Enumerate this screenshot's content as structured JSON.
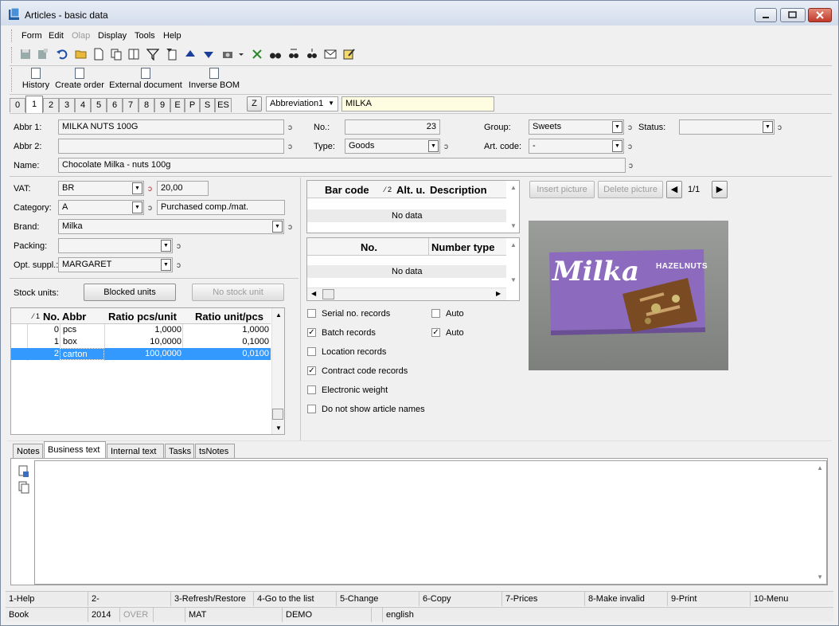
{
  "window": {
    "title": "Articles - basic data"
  },
  "menu": [
    "Form",
    "Edit",
    "Olap",
    "Display",
    "Tools",
    "Help"
  ],
  "actions": [
    "History",
    "Create order",
    "External document",
    "Inverse BOM"
  ],
  "tabs": [
    "0",
    "1",
    "2",
    "3",
    "4",
    "5",
    "6",
    "7",
    "8",
    "9",
    "E",
    "P",
    "S",
    "ES"
  ],
  "tabs_active": "1",
  "z_button": "Z",
  "search": {
    "mode": "Abbreviation1",
    "value": "MILKA"
  },
  "form": {
    "abbr1_label": "Abbr 1:",
    "abbr1": "MILKA NUTS 100G",
    "abbr2_label": "Abbr 2:",
    "abbr2": "",
    "name_label": "Name:",
    "name": "Chocolate Milka - nuts 100g",
    "no_label": "No.:",
    "no": "23",
    "type_label": "Type:",
    "type": "Goods",
    "group_label": "Group:",
    "group": "Sweets",
    "status_label": "Status:",
    "status": "",
    "artcode_label": "Art. code:",
    "artcode": "-",
    "vat_label": "VAT:",
    "vat": "BR",
    "vat_rate": "20,00",
    "category_label": "Category:",
    "category": "A",
    "category_desc": "Purchased comp./mat.",
    "brand_label": "Brand:",
    "brand": "Milka",
    "packing_label": "Packing:",
    "packing": "",
    "supplier_label": "Opt. suppl.:",
    "supplier": "MARGARET"
  },
  "stock": {
    "label": "Stock units:",
    "blocked_button": "Blocked units",
    "no_stock_button": "No stock unit",
    "sort_marker": "⁄ 1",
    "columns": [
      "No.",
      "Abbr",
      "Ratio pcs/unit",
      "Ratio unit/pcs"
    ],
    "rows": [
      {
        "no": "0",
        "abbr": "pcs",
        "ratio1": "1,0000",
        "ratio2": "1,0000"
      },
      {
        "no": "1",
        "abbr": "box",
        "ratio1": "10,0000",
        "ratio2": "0,1000"
      },
      {
        "no": "2",
        "abbr": "carton",
        "ratio1": "100,0000",
        "ratio2": "0,0100"
      }
    ]
  },
  "barcode_grid": {
    "columns": [
      "Bar code",
      "⁄ 2",
      "Alt. u.",
      "Description"
    ],
    "empty": "No data"
  },
  "numbers_grid": {
    "columns": [
      "No.",
      "Number type"
    ],
    "empty": "No data"
  },
  "checkboxes": [
    {
      "label": "Serial no. records",
      "checked": false
    },
    {
      "label": "Batch records",
      "checked": true
    },
    {
      "label": "Location records",
      "checked": false
    },
    {
      "label": "Contract code records",
      "checked": true
    },
    {
      "label": "Electronic weight",
      "checked": false
    },
    {
      "label": "Do not show article names",
      "checked": false
    }
  ],
  "auto_checks": [
    {
      "label": "Auto",
      "checked": false
    },
    {
      "label": "Auto",
      "checked": true
    }
  ],
  "picture": {
    "insert": "Insert picture",
    "delete": "Delete picture",
    "counter": "1/1",
    "brand_text": "Milka",
    "product_text": "HAZELNUTS"
  },
  "bottom_tabs": [
    "Notes",
    "Business text",
    "Internal text",
    "Tasks",
    "tsNotes"
  ],
  "bottom_tabs_active": "Business text",
  "fkeys": [
    "1-Help",
    "2-",
    "3-Refresh/Restore",
    "4-Go to the list",
    "5-Change",
    "6-Copy",
    "7-Prices",
    "8-Make invalid",
    "9-Print",
    "10-Menu"
  ],
  "status": {
    "book": "Book",
    "year": "2014",
    "over": "OVER",
    "mat": "MAT",
    "demo": "DEMO",
    "lang": "english"
  },
  "colors": {
    "selection": "#3399ff",
    "milka_purple": "#8c6bbf"
  }
}
